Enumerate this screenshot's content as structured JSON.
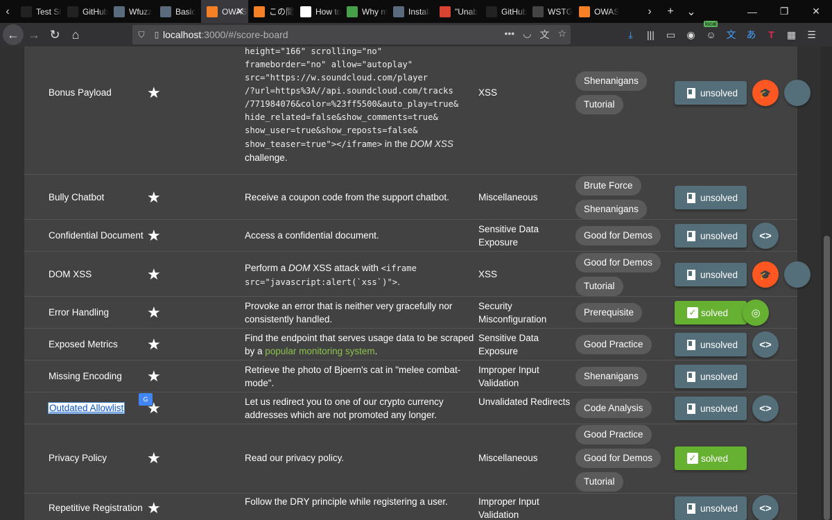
{
  "tabs": [
    {
      "title": "Test Sh",
      "icon": "test-sh-icon",
      "color": "#222"
    },
    {
      "title": "GitHub",
      "icon": "github-icon",
      "color": "#222"
    },
    {
      "title": "Wfuzz",
      "icon": "doc-icon",
      "color": "#5a6b7d"
    },
    {
      "title": "Basic",
      "icon": "doc-icon",
      "color": "#5a6b7d"
    },
    {
      "title": "OWASP",
      "icon": "juice-shop-icon",
      "color": "#f58025",
      "active": true
    },
    {
      "title": "この間",
      "icon": "juice-shop-icon",
      "color": "#f58025"
    },
    {
      "title": "How to",
      "icon": "howto-icon",
      "color": "#fff"
    },
    {
      "title": "Why m",
      "icon": "why-icon",
      "color": "#46a049"
    },
    {
      "title": "Install",
      "icon": "doc-icon",
      "color": "#5a6b7d"
    },
    {
      "title": "\"Unab",
      "icon": "ask-icon",
      "color": "#d94430"
    },
    {
      "title": "GitHub",
      "icon": "github-icon",
      "color": "#222"
    },
    {
      "title": "WSTG",
      "icon": "wstg-icon",
      "color": "#444"
    },
    {
      "title": "OWAS",
      "icon": "juice-shop-icon",
      "color": "#f58025"
    }
  ],
  "url": {
    "host": "localhost",
    "path": ":3000/#/score-board"
  },
  "rows": [
    {
      "name": "Bonus Payload",
      "desc_parts": [
        "height=\"166\" scrolling=\"no\"",
        "frameborder=\"no\" allow=\"autoplay\"",
        "src=\"https://w.soundcloud.com/player",
        "/?url=https%3A//api.soundcloud.com/tracks",
        "/771984076&color=%23ff5500&auto_play=true&",
        "hide_related=false&show_comments=true&",
        "show_user=true&show_reposts=false&",
        "show_teaser=true\"></iframe>"
      ],
      "desc_tail_a": " in the ",
      "desc_tail_em": "DOM XSS",
      "desc_tail_b": "challenge.",
      "category": "XSS",
      "tags": [
        "Shenanigans",
        "Tutorial"
      ],
      "status": "unsolved",
      "extra": "orange"
    },
    {
      "name": "Bully Chatbot",
      "desc": "Receive a coupon code from the support chatbot.",
      "category": "Miscellaneous",
      "tags": [
        "Brute Force",
        "Shenanigans"
      ],
      "status": "unsolved"
    },
    {
      "name": "Confidential Document",
      "desc": "Access a confidential document.",
      "category": "Sensitive Data Exposure",
      "tags": [
        "Good for Demos"
      ],
      "status": "unsolved",
      "extra": "code"
    },
    {
      "name": "DOM XSS",
      "desc_a": "Perform a ",
      "desc_em": "DOM",
      "desc_b": " XSS attack with ",
      "desc_code": "<iframe src=\"javascript:alert(`xss`)\">",
      "desc_c": ".",
      "category": "XSS",
      "tags": [
        "Good for Demos",
        "Tutorial"
      ],
      "status": "unsolved",
      "extra": "orange"
    },
    {
      "name": "Error Handling",
      "desc": "Provoke an error that is neither very gracefully nor consistently handled.",
      "category": "Security Misconfiguration",
      "tags": [
        "Prerequisite"
      ],
      "status": "solved",
      "extra": "green"
    },
    {
      "name": "Exposed Metrics",
      "desc_a": "Find the endpoint that serves usage data to be scraped by a ",
      "desc_link": "popular monitoring system",
      "desc_c": ".",
      "category": "Sensitive Data Exposure",
      "tags": [
        "Good Practice"
      ],
      "status": "unsolved",
      "extra": "code"
    },
    {
      "name": "Missing Encoding",
      "desc": "Retrieve the photo of Bjoern's cat in \"melee combat-mode\".",
      "category": "Improper Input Validation",
      "tags": [
        "Shenanigans"
      ],
      "status": "unsolved"
    },
    {
      "name": "Outdated Allowlist",
      "desc": "Let us redirect you to one of our crypto currency addresses which are not promoted any longer.",
      "category": "Unvalidated Redirects",
      "tags": [
        "Code Analysis"
      ],
      "status": "unsolved",
      "extra": "code"
    },
    {
      "name": "Privacy Policy",
      "desc": "Read our privacy policy.",
      "category": "Miscellaneous",
      "tags": [
        "Good Practice",
        "Good for Demos",
        "Tutorial"
      ],
      "status": "solved"
    },
    {
      "name": "Repetitive Registration",
      "desc": "Follow the DRY principle while registering a user.",
      "category": "Improper Input Validation",
      "tags": [],
      "status": "unsolved",
      "extra": "code"
    }
  ],
  "labels": {
    "unsolved": "unsolved",
    "solved": "solved"
  },
  "translate_badge": "G"
}
